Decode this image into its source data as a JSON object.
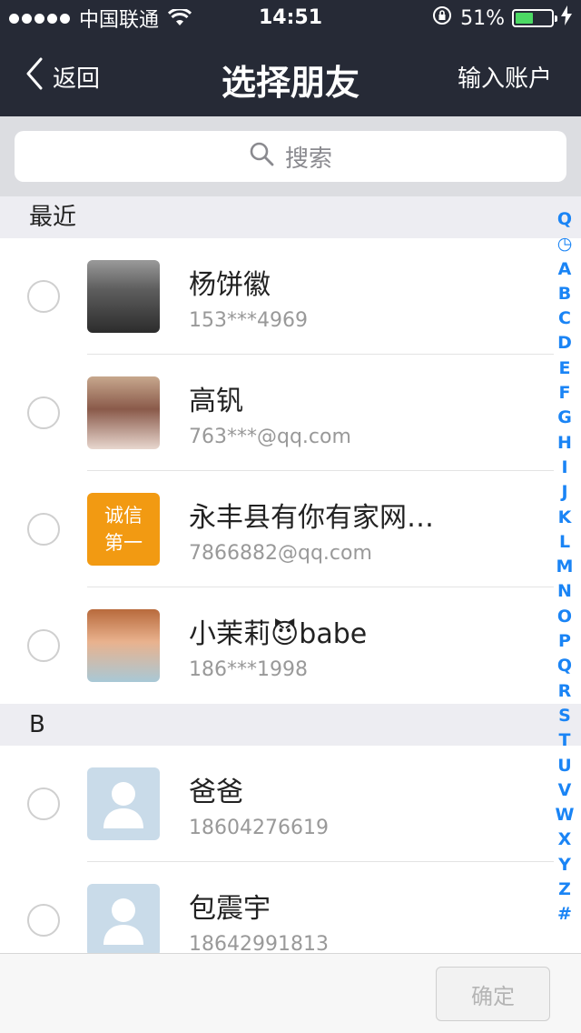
{
  "status_bar": {
    "carrier": "中国联通",
    "time": "14:51",
    "battery": "51%",
    "battery_level": 0.51,
    "icons": [
      "signal-icon",
      "wifi-icon",
      "rotation-lock-icon",
      "battery-icon",
      "charging-icon"
    ]
  },
  "nav": {
    "back_label": "返回",
    "title": "选择朋友",
    "right_label": "输入账户"
  },
  "search": {
    "placeholder": "搜索"
  },
  "sections": [
    {
      "header": "最近",
      "contacts": [
        {
          "name": "杨饼徽",
          "sub": "153***4969",
          "avatar": "photo"
        },
        {
          "name": "高钒",
          "sub": "763***@qq.com",
          "avatar": "photo"
        },
        {
          "name": "永丰县有你有家网…",
          "sub": "7866882@qq.com",
          "avatar": "badge",
          "avatar_text": "诚信\n第一"
        },
        {
          "name": "小茉莉😈babe",
          "sub": "186***1998",
          "avatar": "photo"
        }
      ]
    },
    {
      "header": "B",
      "contacts": [
        {
          "name": "爸爸",
          "sub": "18604276619",
          "avatar": "default"
        },
        {
          "name": "包震宇",
          "sub": "18642991813",
          "avatar": "default"
        }
      ]
    }
  ],
  "index_letters": [
    "Q",
    "◷",
    "A",
    "B",
    "C",
    "D",
    "E",
    "F",
    "G",
    "H",
    "I",
    "J",
    "K",
    "L",
    "M",
    "N",
    "O",
    "P",
    "Q",
    "R",
    "S",
    "T",
    "U",
    "V",
    "W",
    "X",
    "Y",
    "Z",
    "#"
  ],
  "bottom": {
    "confirm_label": "确定"
  },
  "colors": {
    "nav_bg": "#262a36",
    "index_blue": "#1a84f5",
    "battery_green": "#4cd964",
    "badge_orange": "#f29a12"
  }
}
